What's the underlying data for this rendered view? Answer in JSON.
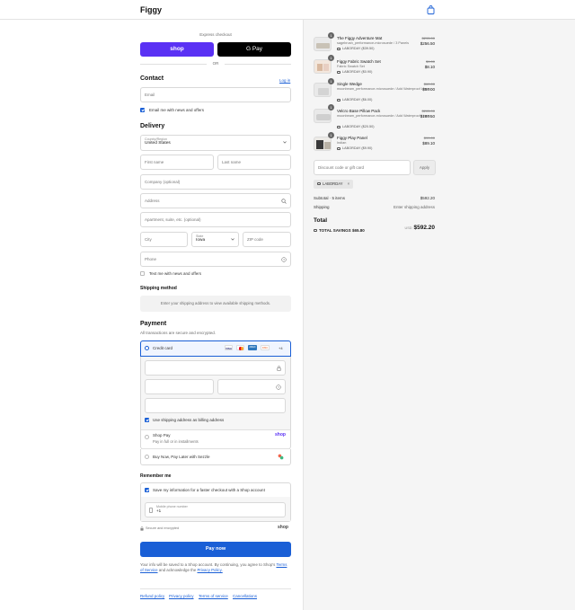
{
  "header": {
    "brand": "Figgy"
  },
  "express": {
    "label": "Express checkout",
    "shop_label": "shop",
    "gpay_label": "G Pay",
    "or_label": "OR"
  },
  "contact": {
    "title": "Contact",
    "login_label": "Log in",
    "email_placeholder": "Email",
    "news_label": "Email me with news and offers"
  },
  "delivery": {
    "title": "Delivery",
    "country_label": "Country/Region",
    "country_value": "United States",
    "first_name": "First name",
    "last_name": "Last name",
    "company": "Company (optional)",
    "address": "Address",
    "apartment": "Apartment, suite, etc. (optional)",
    "city": "City",
    "state_label": "State",
    "state_value": "Iowa",
    "zip": "ZIP code",
    "phone": "Phone",
    "text_label": "Text me with news and offers"
  },
  "shipping": {
    "title": "Shipping method",
    "message": "Enter your shipping address to view available shipping methods."
  },
  "payment": {
    "title": "Payment",
    "subtitle": "All transactions are secure and encrypted.",
    "credit_card": "Credit card",
    "brands": [
      "VISA",
      "MC",
      "AMEX",
      "DISC"
    ],
    "more_brands": "+4",
    "billing_label": "Use shipping address as billing address",
    "shop_pay_title": "Shop Pay",
    "shop_pay_sub": "Pay in full or in installments",
    "shop_pay_logo": "shop",
    "sezzle": "Buy Now, Pay Later with Sezzle"
  },
  "remember": {
    "title": "Remember me",
    "save_label": "Save my information for a faster checkout with a Shop account",
    "mobile_label": "Mobile phone number",
    "mobile_prefix": "+1",
    "secure_label": "Secure and encrypted",
    "shop_logo": "shop"
  },
  "pay_button": "Pay now",
  "legal": {
    "line1": "Your info will be saved to a Shop account. By continuing, you agree to Shop's",
    "terms": "Terms of Service",
    "mid": "and acknowledge the",
    "privacy": "Privacy Policy."
  },
  "footer": {
    "links": [
      "Refund policy",
      "Privacy policy",
      "Terms of service",
      "Cancellations"
    ]
  },
  "order": {
    "items": [
      {
        "qty": "1",
        "name": "The Figgy Adventure Mat",
        "variant": "sagebrush_performance-microsuede / 3 Panels",
        "discount": "LABORDAY ($39.50)",
        "original": "$295.00",
        "final": "$256.50"
      },
      {
        "qty": "1",
        "name": "Figgy Fabric Swatch Set",
        "variant": "Fabric Swatch Set",
        "discount": "LABORDAY ($0.90)",
        "original": "$9.00",
        "final": "$8.10"
      },
      {
        "qty": "1",
        "name": "Single Wedge",
        "variant": "moonbeam_performance-microsuede / Add Waterproof Liners",
        "discount": "LABORDAY ($6.00)",
        "original": "$60.00",
        "final": "$54.00"
      },
      {
        "qty": "1",
        "name": "Velcro Base Pillow Pack",
        "variant": "moonbeam_performance-microsuede / Add Waterproof Liners",
        "discount": "LABORDAY ($20.50)",
        "original": "$205.00",
        "final": "$184.50"
      },
      {
        "qty": "1",
        "name": "Figgy Play Panel",
        "variant": "Indian",
        "discount": "LABORDAY ($9.90)",
        "original": "$99.00",
        "final": "$89.10"
      }
    ],
    "discount_placeholder": "Discount code or gift card",
    "apply_label": "Apply",
    "applied_code": "LABORDAY",
    "subtotal_label": "Subtotal · 5 items",
    "subtotal_value": "$592.20",
    "shipping_label": "Shipping",
    "shipping_value": "Enter shipping address",
    "total_label": "Total",
    "currency": "USD",
    "total_value": "$592.20",
    "savings_label": "TOTAL SAVINGS",
    "savings_value": "$65.80"
  }
}
